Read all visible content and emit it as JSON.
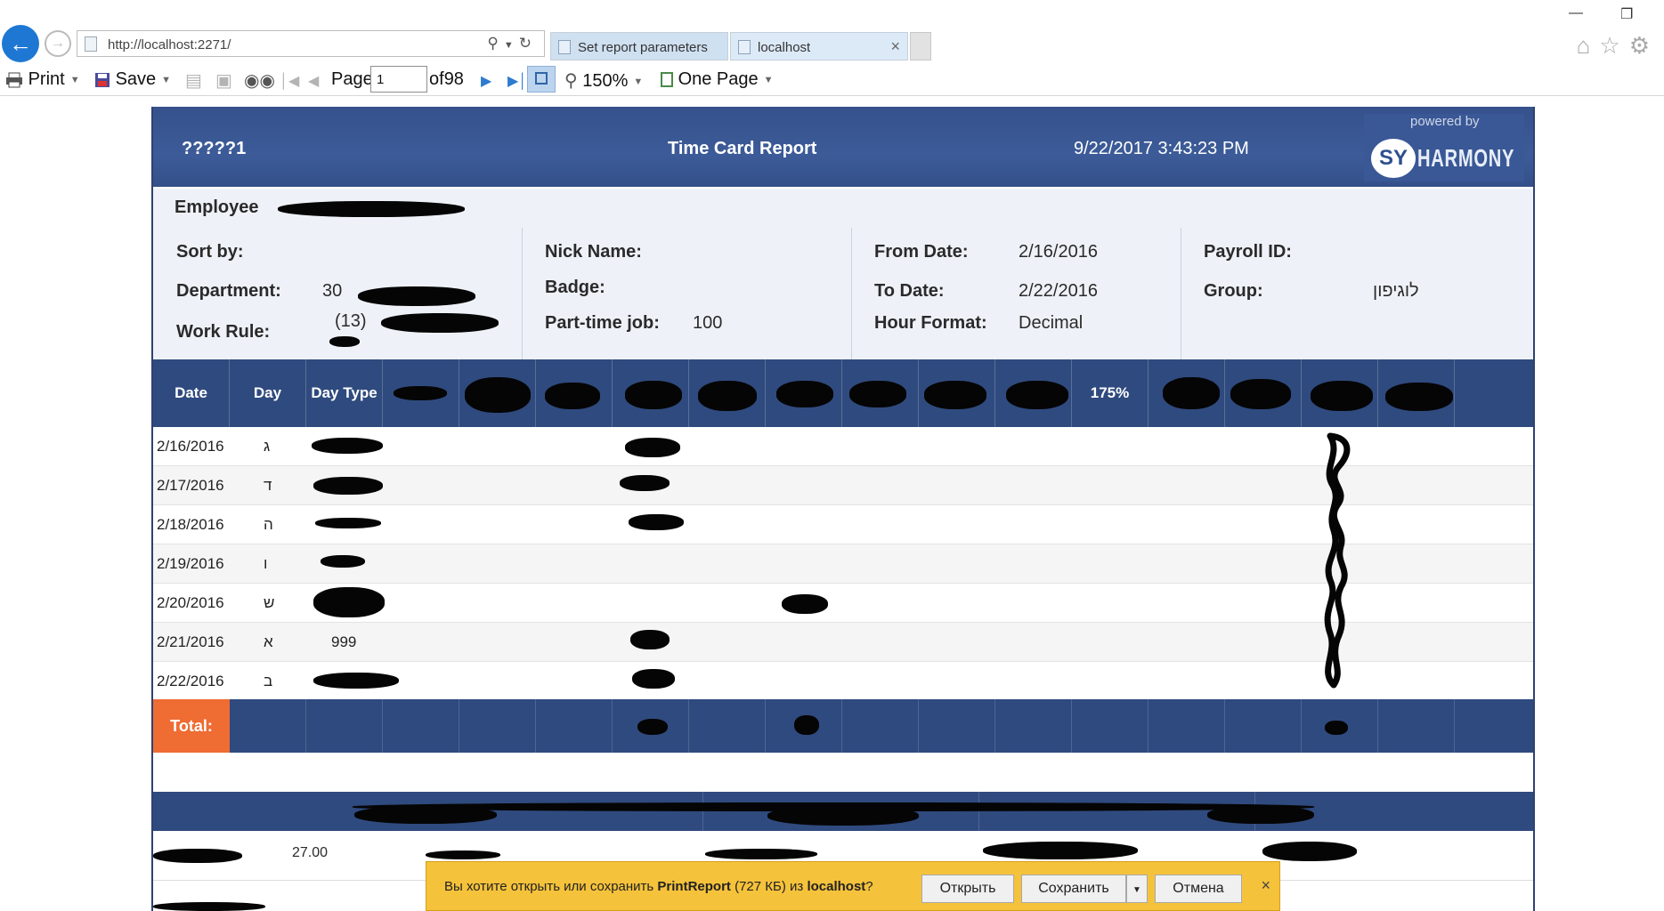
{
  "browser": {
    "url": "http://localhost:2271/",
    "tabs": [
      {
        "label": "Set report parameters"
      },
      {
        "label": "localhost"
      }
    ],
    "close_tab_glyph": "×",
    "window_restore_glyph": "❐",
    "window_minimize_glyph": "—"
  },
  "toolbar": {
    "print_label": "Print",
    "save_label": "Save",
    "page_label": "Page",
    "page_value": "1",
    "of_label": "of",
    "total_pages": "98",
    "zoom_label": "150%",
    "view_label": "One Page"
  },
  "report": {
    "id": "?????1",
    "title": "Time Card Report",
    "datetime": "9/22/2017 3:43:23 PM",
    "logo": {
      "powered_by": "powered by",
      "sy": "SY",
      "brand": "HARMONY"
    },
    "employee_label": "Employee",
    "fields": {
      "sort_by_label": "Sort by:",
      "department_label": "Department:",
      "department_value": "30",
      "work_rule_label": "Work Rule:",
      "work_rule_value": "(13)",
      "nick_name_label": "Nick Name:",
      "badge_label": "Badge:",
      "part_time_label": "Part-time job:",
      "part_time_value": "100",
      "from_date_label": "From Date:",
      "from_date_value": "2/16/2016",
      "to_date_label": "To Date:",
      "to_date_value": "2/22/2016",
      "hour_format_label": "Hour Format:",
      "hour_format_value": "Decimal",
      "payroll_label": "Payroll ID:",
      "group_label": "Group:",
      "group_value": "לוגיפון"
    },
    "table": {
      "headers": {
        "date": "Date",
        "day": "Day",
        "day_type": "Day Type",
        "pct175": "175%"
      },
      "rows": [
        {
          "date": "2/16/2016",
          "day": "ג",
          "day_type": ""
        },
        {
          "date": "2/17/2016",
          "day": "ד",
          "day_type": ""
        },
        {
          "date": "2/18/2016",
          "day": "ה",
          "day_type": ""
        },
        {
          "date": "2/19/2016",
          "day": "ו",
          "day_type": ""
        },
        {
          "date": "2/20/2016",
          "day": "ש",
          "day_type": ""
        },
        {
          "date": "2/21/2016",
          "day": "א",
          "day_type": "999"
        },
        {
          "date": "2/22/2016",
          "day": "ב",
          "day_type": ""
        }
      ],
      "total_label": "Total:"
    },
    "summary": {
      "value": "27.00"
    }
  },
  "download_bar": {
    "msg_prefix": "Вы хотите открыть или сохранить ",
    "file_name": "PrintReport",
    "file_size": " (727 КБ) из ",
    "host": "localhost",
    "msg_suffix": "?",
    "open_label": "Открыть",
    "save_label": "Сохранить",
    "cancel_label": "Отмена",
    "close_glyph": "×"
  }
}
